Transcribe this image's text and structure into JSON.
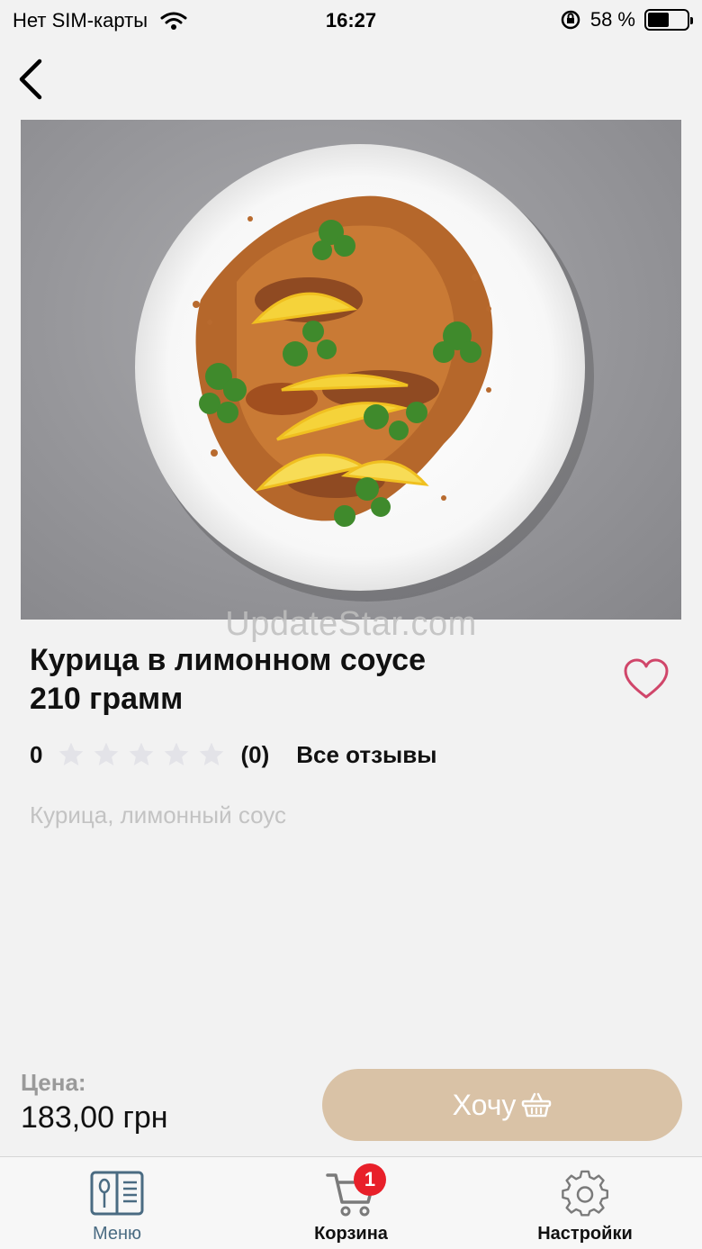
{
  "status_bar": {
    "carrier": "Нет SIM-карты",
    "time": "16:27",
    "battery": "58 %",
    "battery_level": 0.58
  },
  "product": {
    "title_line1": "Курица в лимонном соусе",
    "title_line2": "210 грамм",
    "rating_value": "0",
    "rating_stars": 0,
    "reviews_count": "(0)",
    "all_reviews_label": "Все отзывы",
    "ingredients": "Курица, лимонный соус",
    "price_label": "Цена:",
    "price": "183,00 грн",
    "want_button_label": "Хочу"
  },
  "watermark": "UpdateStar.com",
  "tabs": [
    {
      "label": "Меню",
      "icon": "menu-book-icon"
    },
    {
      "label": "Корзина",
      "icon": "cart-icon",
      "badge": "1"
    },
    {
      "label": "Настройки",
      "icon": "gear-icon"
    }
  ],
  "colors": {
    "accent_button": "#d9c2a6",
    "heart": "#d0466a",
    "badge": "#e8202a",
    "active_tab": "#4a6b82"
  }
}
